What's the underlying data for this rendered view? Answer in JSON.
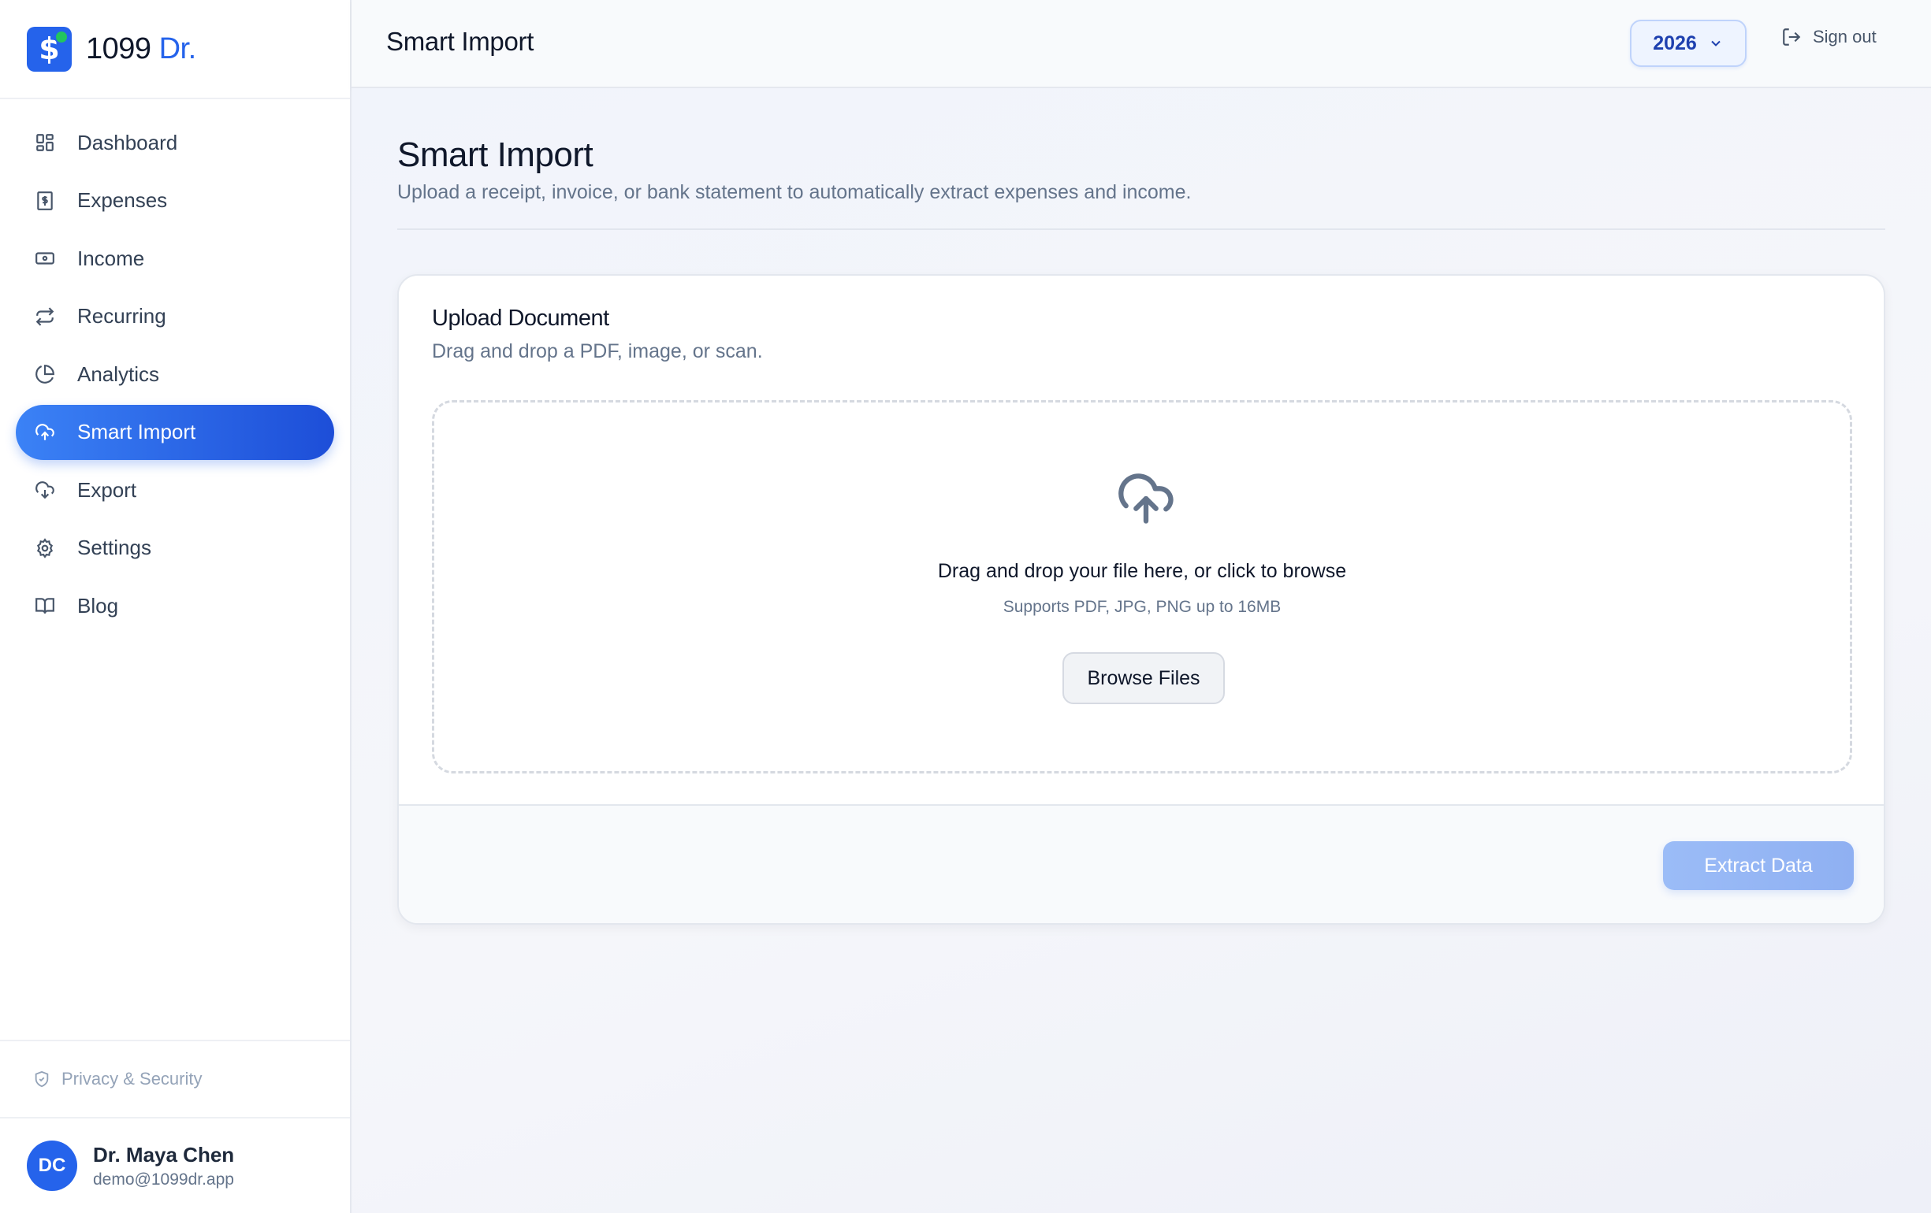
{
  "brand": {
    "name_prefix": "1099",
    "name_suffix": "Dr.",
    "logo_glyph": "$"
  },
  "sidebar": {
    "items": [
      {
        "label": "Dashboard",
        "icon": "grid-icon",
        "active": false
      },
      {
        "label": "Expenses",
        "icon": "receipt-icon",
        "active": false
      },
      {
        "label": "Income",
        "icon": "banknote-icon",
        "active": false
      },
      {
        "label": "Recurring",
        "icon": "repeat-icon",
        "active": false
      },
      {
        "label": "Analytics",
        "icon": "pie-chart-icon",
        "active": false
      },
      {
        "label": "Smart Import",
        "icon": "cloud-upload-icon",
        "active": true
      },
      {
        "label": "Export",
        "icon": "cloud-download-icon",
        "active": false
      },
      {
        "label": "Settings",
        "icon": "gear-icon",
        "active": false
      },
      {
        "label": "Blog",
        "icon": "book-icon",
        "active": false
      }
    ],
    "privacy_label": "Privacy & Security",
    "user": {
      "initials": "DC",
      "name": "Dr. Maya Chen",
      "email": "demo@1099dr.app"
    }
  },
  "header": {
    "title": "Smart Import",
    "year": "2026",
    "signout_label": "Sign out"
  },
  "main": {
    "title": "Smart Import",
    "subtitle": "Upload a receipt, invoice, or bank statement to automatically extract expenses and income.",
    "card": {
      "title": "Upload Document",
      "subtitle": "Drag and drop a PDF, image, or scan.",
      "dropzone_text": "Drag and drop your file here, or click to browse",
      "dropzone_hint": "Supports PDF, JPG, PNG up to 16MB",
      "browse_label": "Browse Files",
      "extract_label": "Extract Data"
    }
  },
  "colors": {
    "accent": "#2563eb",
    "accent_dark": "#1d4ed8",
    "disabled_button": "#9bbcf7",
    "status_dot": "#22c55e"
  }
}
